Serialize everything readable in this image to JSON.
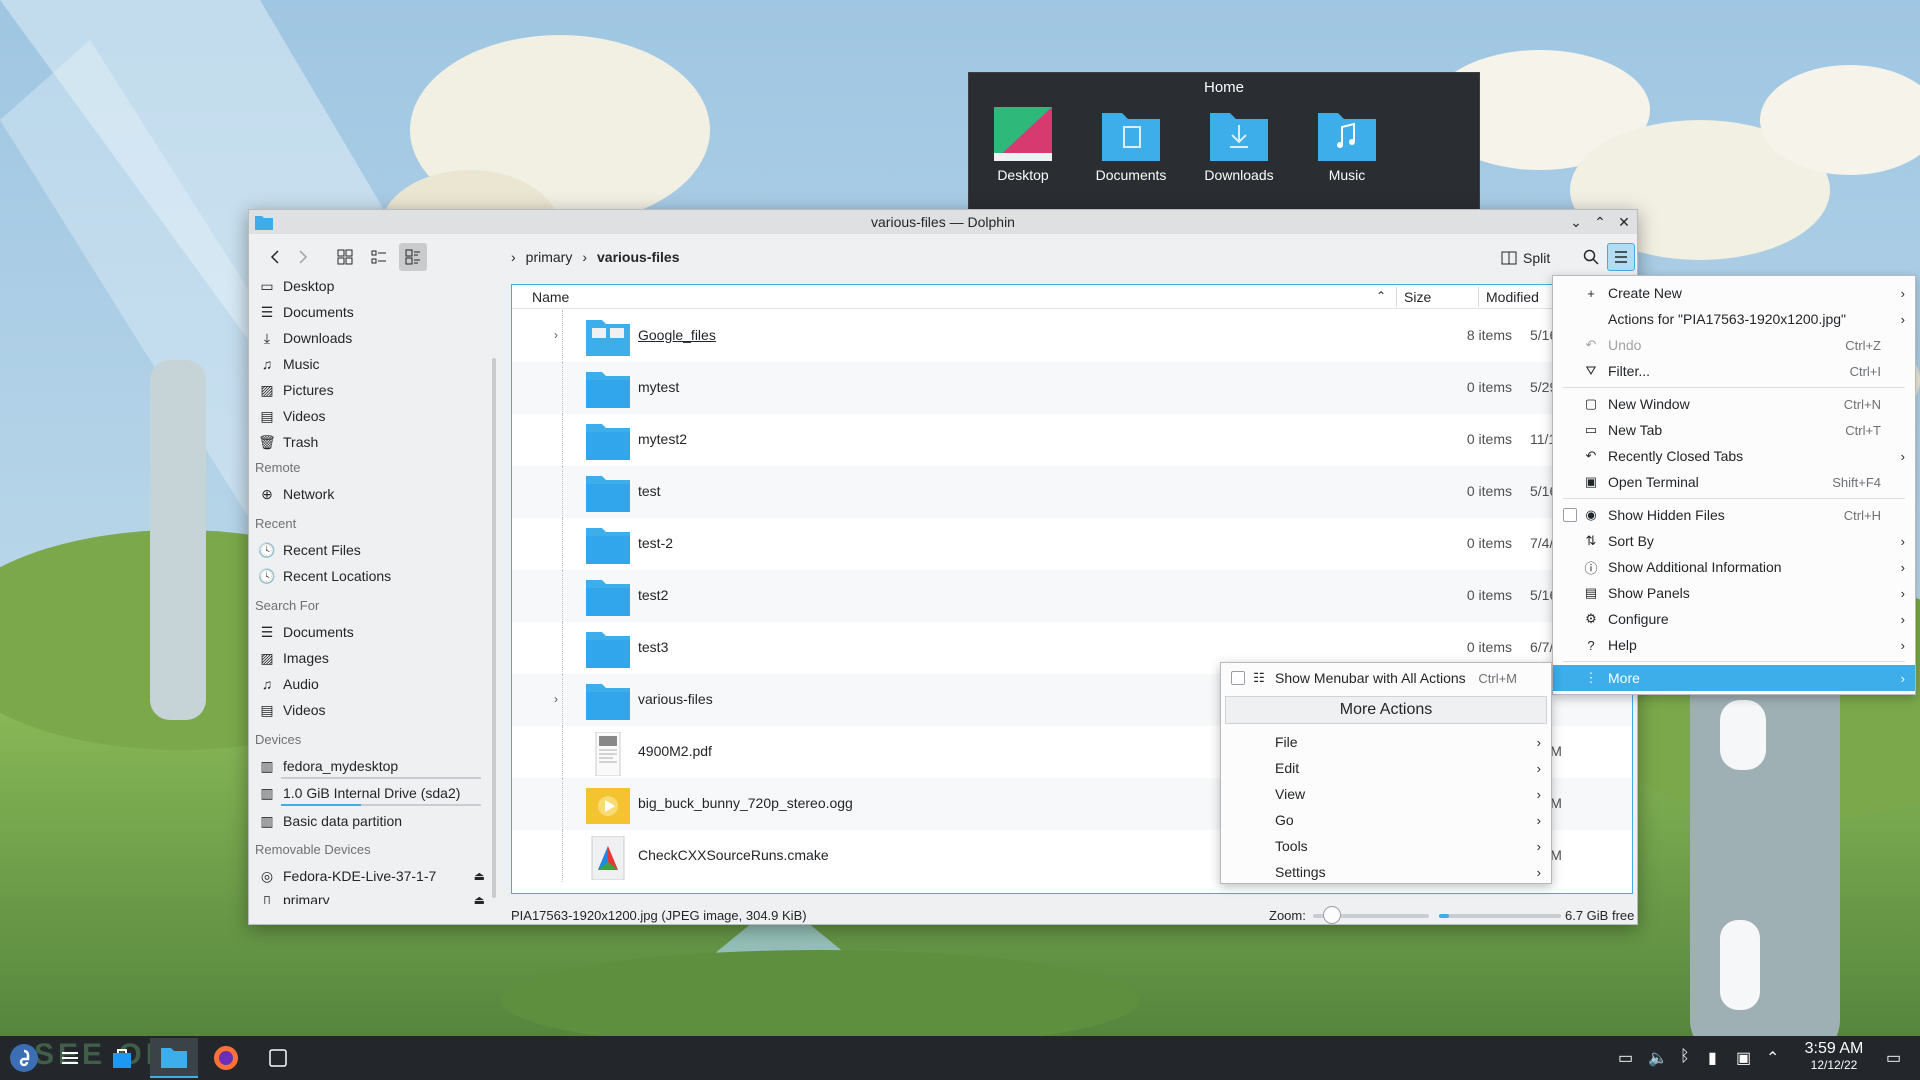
{
  "home_popup": {
    "title": "Home",
    "items": [
      "Desktop",
      "Documents",
      "Downloads",
      "Music"
    ]
  },
  "window": {
    "title": "various-files — Dolphin",
    "breadcrumb": [
      "primary",
      "various-files"
    ],
    "split_label": "Split"
  },
  "sidebar": {
    "places": [
      "Desktop",
      "Documents",
      "Downloads",
      "Music",
      "Pictures",
      "Videos",
      "Trash"
    ],
    "remote_heading": "Remote",
    "remote": [
      "Network"
    ],
    "recent_heading": "Recent",
    "recent": [
      "Recent Files",
      "Recent Locations"
    ],
    "search_heading": "Search For",
    "search": [
      "Documents",
      "Images",
      "Audio",
      "Videos"
    ],
    "devices_heading": "Devices",
    "devices": [
      "fedora_mydesktop",
      "1.0 GiB Internal Drive (sda2)",
      "Basic data partition"
    ],
    "removable_heading": "Removable Devices",
    "removable": [
      "Fedora-KDE-Live-37-1-7",
      "primary"
    ]
  },
  "columns": {
    "name": "Name",
    "size": "Size",
    "modified": "Modified"
  },
  "files": [
    {
      "name": "Google_files",
      "size": "8 items",
      "modified": "5/16/22 at 9:0",
      "kind": "folder-special",
      "expandable": true
    },
    {
      "name": "mytest",
      "size": "0 items",
      "modified": "5/29/22 at 9:3",
      "kind": "folder"
    },
    {
      "name": "mytest2",
      "size": "0 items",
      "modified": "11/18/22 at 7:",
      "kind": "folder"
    },
    {
      "name": "test",
      "size": "0 items",
      "modified": "5/16/22 at 9:0",
      "kind": "folder"
    },
    {
      "name": "test-2",
      "size": "0 items",
      "modified": "7/4/22 at 4:05",
      "kind": "folder"
    },
    {
      "name": "test2",
      "size": "0 items",
      "modified": "5/16/22 at 9:1",
      "kind": "folder"
    },
    {
      "name": "test3",
      "size": "0 items",
      "modified": "6/7/22 at 7:57",
      "kind": "folder"
    },
    {
      "name": "various-files",
      "size": "",
      "modified": "PM",
      "kind": "folder",
      "expandable": true
    },
    {
      "name": "4900M2.pdf",
      "size": "",
      "modified": "5 AM",
      "kind": "pdf"
    },
    {
      "name": "big_buck_bunny_720p_stereo.ogg",
      "size": "",
      "modified": "5 AM",
      "kind": "video"
    },
    {
      "name": "CheckCXXSourceRuns.cmake",
      "size": "",
      "modified": "5 AM",
      "kind": "cmake"
    }
  ],
  "status": {
    "text": "PIA17563-1920x1200.jpg (JPEG image, 304.9 KiB)",
    "zoom_label": "Zoom:",
    "free": "6.7 GiB free",
    "free_used_fraction": 0.08
  },
  "main_menu": [
    {
      "icon": "+",
      "label": "Create New",
      "shortcut": "",
      "submenu": true
    },
    {
      "icon": "",
      "label": "Actions for \"PIA17563-1920x1200.jpg\"",
      "shortcut": "",
      "submenu": true
    },
    {
      "icon": "↶",
      "label": "Undo",
      "shortcut": "Ctrl+Z",
      "disabled": true
    },
    {
      "icon": "⛛",
      "label": "Filter...",
      "shortcut": "Ctrl+I"
    },
    {
      "icon": "▢",
      "label": "New Window",
      "shortcut": "Ctrl+N"
    },
    {
      "icon": "▭",
      "label": "New Tab",
      "shortcut": "Ctrl+T"
    },
    {
      "icon": "↶",
      "label": "Recently Closed Tabs",
      "shortcut": "",
      "submenu": true
    },
    {
      "icon": "▣",
      "label": "Open Terminal",
      "shortcut": "Shift+F4"
    },
    {
      "icon": "◉",
      "label": "Show Hidden Files",
      "shortcut": "Ctrl+H",
      "checkbox": true
    },
    {
      "icon": "⇅",
      "label": "Sort By",
      "shortcut": "",
      "submenu": true
    },
    {
      "icon": "ⓘ",
      "label": "Show Additional Information",
      "shortcut": "",
      "submenu": true
    },
    {
      "icon": "▤",
      "label": "Show Panels",
      "shortcut": "",
      "submenu": true
    },
    {
      "icon": "⚙",
      "label": "Configure",
      "shortcut": "",
      "submenu": true
    },
    {
      "icon": "?",
      "label": "Help",
      "shortcut": "",
      "submenu": true
    },
    {
      "icon": "⋮",
      "label": "More",
      "shortcut": "",
      "submenu": true,
      "highlighted": true
    }
  ],
  "more_menu": {
    "show_menubar": {
      "label": "Show Menubar with All Actions",
      "shortcut": "Ctrl+M"
    },
    "title": "More Actions",
    "items": [
      "File",
      "Edit",
      "View",
      "Go",
      "Tools",
      "Settings"
    ]
  },
  "taskbar": {
    "time": "3:59 AM",
    "date": "12/12/22",
    "watermark": "SEE  OM"
  },
  "colors": {
    "accent": "#3daee9",
    "folder": "#3daee9",
    "panel_dark": "#2a2e32",
    "taskbar": "#23272b"
  }
}
